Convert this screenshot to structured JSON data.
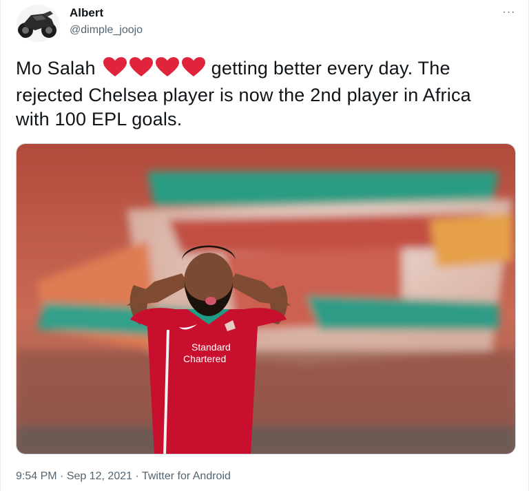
{
  "tweet": {
    "author": {
      "name": "Albert",
      "handle": "@dimple_joojo",
      "avatar_icon": "motorcycle-avatar"
    },
    "more_icon": "more-dots-icon",
    "more_label": "···",
    "text": {
      "before_emoji": "Mo Salah",
      "emoji": [
        "red-heart",
        "red-heart",
        "red-heart",
        "red-heart"
      ],
      "after_emoji_line1": "getting better every day.  The",
      "line2": "rejected Chelsea player is now the 2nd player in Africa",
      "line3": "with  100 EPL goals."
    },
    "media": {
      "kit_sponsor_line1": "Standard",
      "kit_sponsor_line2": "Chartered"
    },
    "meta": {
      "time": "9:54 PM",
      "separator": " · ",
      "date": "Sep 12, 2021",
      "source": "Twitter for Android"
    }
  },
  "colors": {
    "heart": "#e0243b",
    "muted_text": "#536471",
    "jersey_red": "#c8102e",
    "liverbird_green": "#1f9c84"
  }
}
